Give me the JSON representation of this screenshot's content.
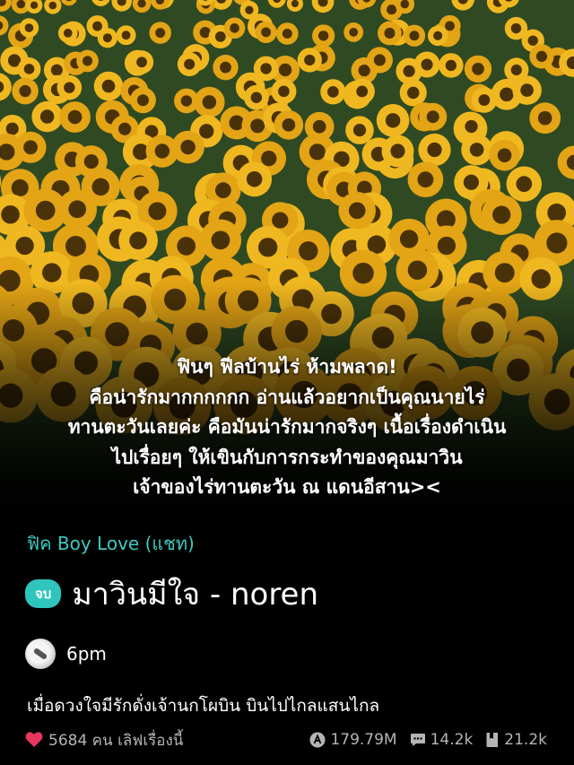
{
  "hero": {
    "image": "sunflower-field-photo",
    "synopsis": "ฟินๆ ฟีลบ้านไร่ ห้ามพลาด!\nคือน่ารักมากกกกกก อ่านแล้วอยากเป็นคุณนายไร่\nทานตะวันเลยค่ะ คือมันน่ารักมากจริงๆ เนื้อเรื่องดำเนิน\nไปเรื่อยๆ ให้เขินกับการกระทำของคุณมาวิน\nเจ้าของไร่ทานตะวัน ณ แดนอีสาน><"
  },
  "story": {
    "category": "ฟิค Boy Love (แชท)",
    "status_badge": "จบ",
    "title": "มาวินมีใจ - noren",
    "author": "6pm",
    "description": "เมื่อดวงใจมีรักดั่งเจ้านกโผบิน บินไปไกลแสนไกล"
  },
  "stats": {
    "likes_text": "5684 คน เลิฟเรื่องนี้",
    "views": "179.79M",
    "comments": "14.2k",
    "chapters": "21.2k"
  },
  "colors": {
    "accent": "#2fc5bd",
    "category": "#3ec9c0",
    "heart": "#e8365d",
    "stat_gray": "#b5b5b5"
  }
}
